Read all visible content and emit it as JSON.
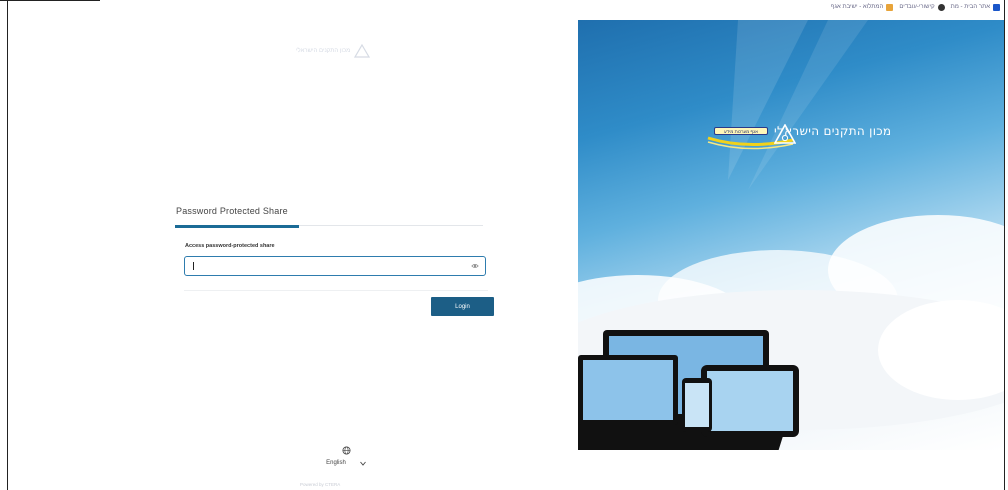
{
  "bookmarks": [
    {
      "label": "אתר הבית - מת",
      "icon": "bookmark-blue-icon",
      "color": "#1a56c9"
    },
    {
      "label": "קישורי-עובדים",
      "icon": "chrome-icon",
      "color": "#333333"
    },
    {
      "label": "המתלוא - ישיבת אגף",
      "icon": "folder-orange-icon",
      "color": "#e8a43a"
    }
  ],
  "left": {
    "small_logo_text": "מכון התקנים הישראלי",
    "tab_label": "Password Protected Share",
    "field_label": "Access password-protected share",
    "input_value": "",
    "login_label": "Login",
    "language": "English",
    "powered_by": "Powered by CTERA"
  },
  "hero": {
    "brand_name": "מכון התקנים הישראלי",
    "badge_text": "אגף מערכות מידע"
  },
  "colors": {
    "primary": "#1c5e86",
    "tab_underline": "#1b6b96",
    "input_border": "#2e7cae"
  }
}
